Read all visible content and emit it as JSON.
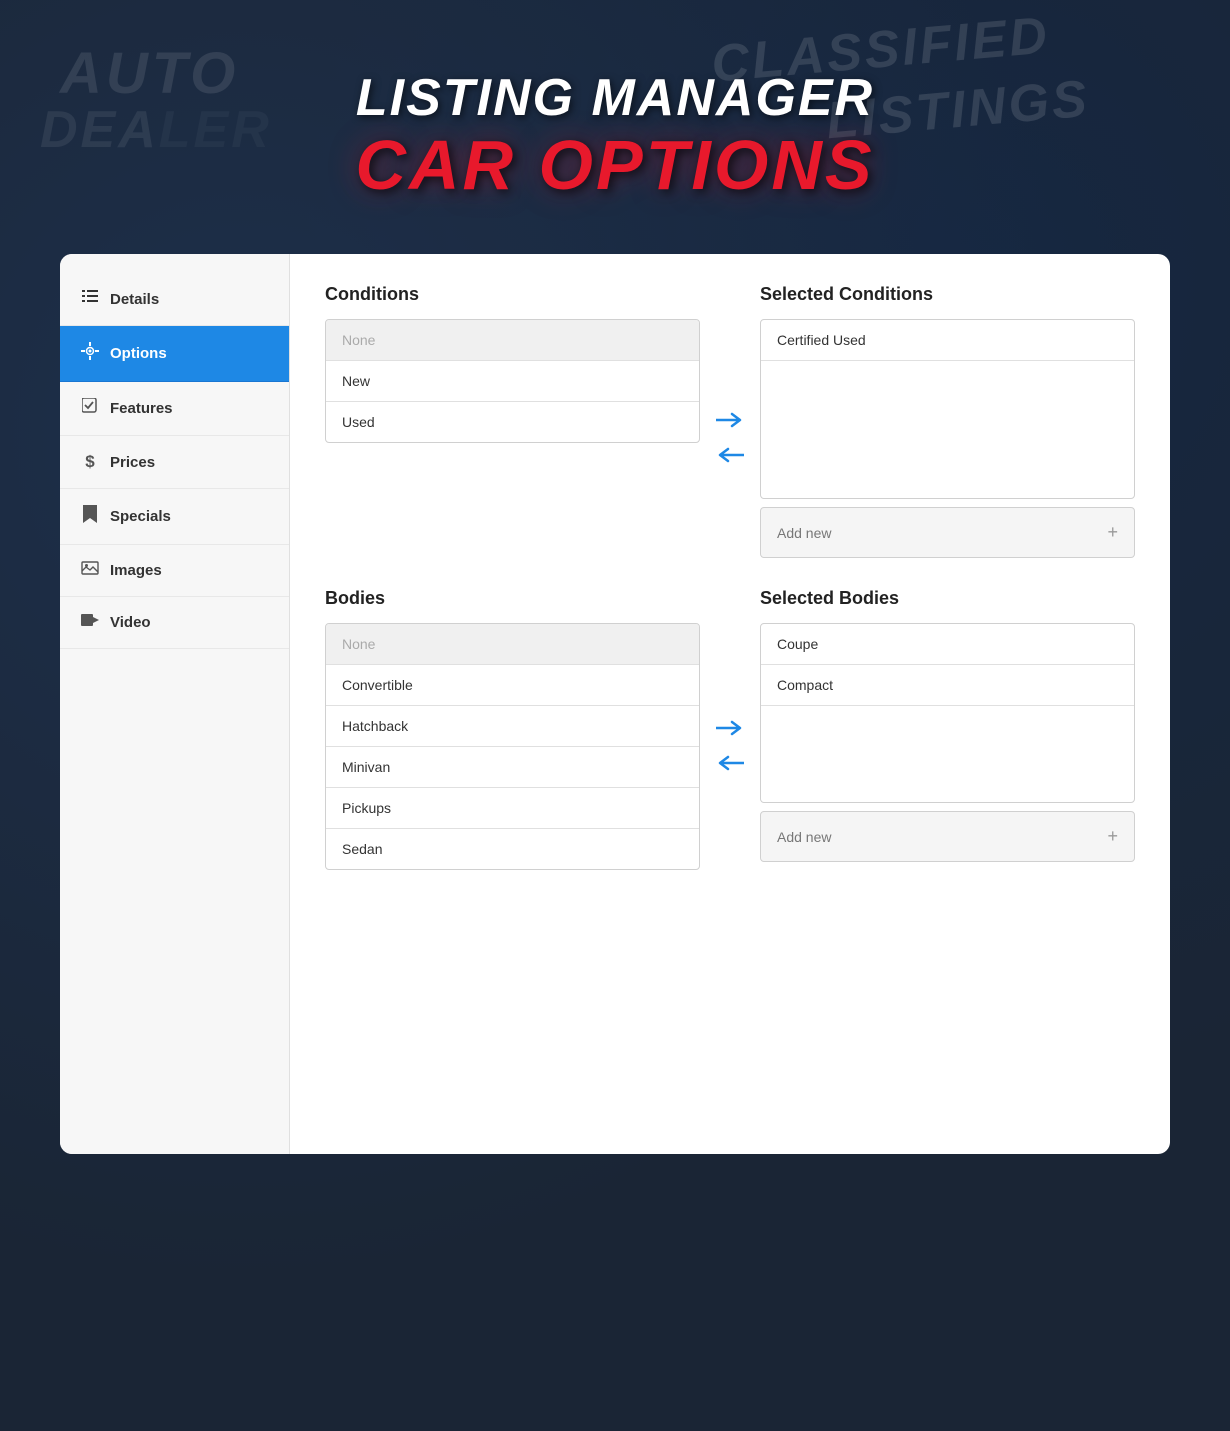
{
  "header": {
    "line1": "LISTING MANAGER",
    "line2": "CAR OPTIONS"
  },
  "sidebar": {
    "items": [
      {
        "id": "details",
        "label": "Details",
        "icon": "≡"
      },
      {
        "id": "options",
        "label": "Options",
        "icon": "⚙",
        "active": true
      },
      {
        "id": "features",
        "label": "Features",
        "icon": "☑"
      },
      {
        "id": "prices",
        "label": "Prices",
        "icon": "$"
      },
      {
        "id": "specials",
        "label": "Specials",
        "icon": "🔖"
      },
      {
        "id": "images",
        "label": "Images",
        "icon": "🖼"
      },
      {
        "id": "video",
        "label": "Video",
        "icon": "▶"
      }
    ]
  },
  "conditions": {
    "section_title": "Conditions",
    "selected_title": "Selected Conditions",
    "available_items": [
      {
        "label": "None",
        "type": "none"
      },
      {
        "label": "New"
      },
      {
        "label": "Used"
      }
    ],
    "selected_items": [
      {
        "label": "Certified Used"
      }
    ],
    "add_new_label": "Add new"
  },
  "bodies": {
    "section_title": "Bodies",
    "selected_title": "Selected Bodies",
    "available_items": [
      {
        "label": "None",
        "type": "none"
      },
      {
        "label": "Convertible"
      },
      {
        "label": "Hatchback"
      },
      {
        "label": "Minivan"
      },
      {
        "label": "Pickups"
      },
      {
        "label": "Sedan"
      }
    ],
    "selected_items": [
      {
        "label": "Coupe"
      },
      {
        "label": "Compact"
      }
    ],
    "add_new_label": "Add new"
  },
  "colors": {
    "accent_blue": "#1e88e5",
    "accent_red": "#e8192c",
    "sidebar_active_bg": "#1e88e5",
    "sidebar_bg": "#f7f7f7"
  }
}
